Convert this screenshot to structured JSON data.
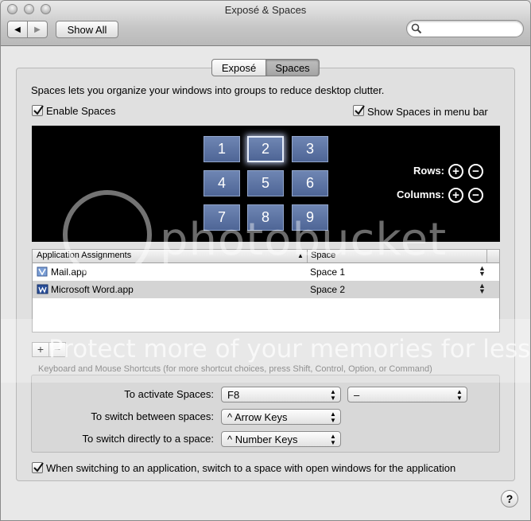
{
  "window": {
    "title": "Exposé & Spaces"
  },
  "toolbar": {
    "back_glyph": "◀",
    "forward_glyph": "▶",
    "show_all_label": "Show All",
    "search_placeholder": "",
    "search_icon": "search-icon"
  },
  "tabs": [
    {
      "label": "Exposé",
      "selected": false
    },
    {
      "label": "Spaces",
      "selected": true
    }
  ],
  "spaces": {
    "description": "Spaces lets you organize your windows into groups to reduce desktop clutter.",
    "enable_label": "Enable Spaces",
    "enable_checked": true,
    "menu_bar_label": "Show Spaces in menu bar",
    "menu_bar_checked": true,
    "tiles": [
      "1",
      "2",
      "3",
      "4",
      "5",
      "6",
      "7",
      "8",
      "9"
    ],
    "selected_tile": "2",
    "rows_label": "Rows:",
    "columns_label": "Columns:",
    "plus_glyph": "+",
    "minus_glyph": "−"
  },
  "assignments": {
    "col_app": "Application Assignments",
    "col_space": "Space",
    "sort_glyph": "▲",
    "rows": [
      {
        "app": "Mail.app",
        "space": "Space 1",
        "icon": "mail-app-icon",
        "selected": false
      },
      {
        "app": "Microsoft Word.app",
        "space": "Space 2",
        "icon": "word-app-icon",
        "selected": true
      }
    ],
    "add_glyph": "+",
    "remove_glyph": "−"
  },
  "shortcuts": {
    "header": "Keyboard and Mouse Shortcuts (for more shortcut choices, press Shift, Control, Option, or Command)",
    "activate_label": "To activate Spaces:",
    "activate_value": "F8",
    "activate_mouse_value": "–",
    "switch_between_label": "To switch between spaces:",
    "switch_between_value": "^ Arrow Keys",
    "switch_direct_label": "To switch directly to a space:",
    "switch_direct_value": "^ Number Keys"
  },
  "switch_app": {
    "label": "When switching to an application, switch to a space with open windows for the application",
    "checked": true
  },
  "help_glyph": "?",
  "watermark": {
    "line1": "photobucket",
    "line2": "Protect more of your memories for less!"
  },
  "colors": {
    "tile_blue": "#5a72a3",
    "preview_bg": "#000000",
    "selected_row": "#d4d4d4"
  }
}
